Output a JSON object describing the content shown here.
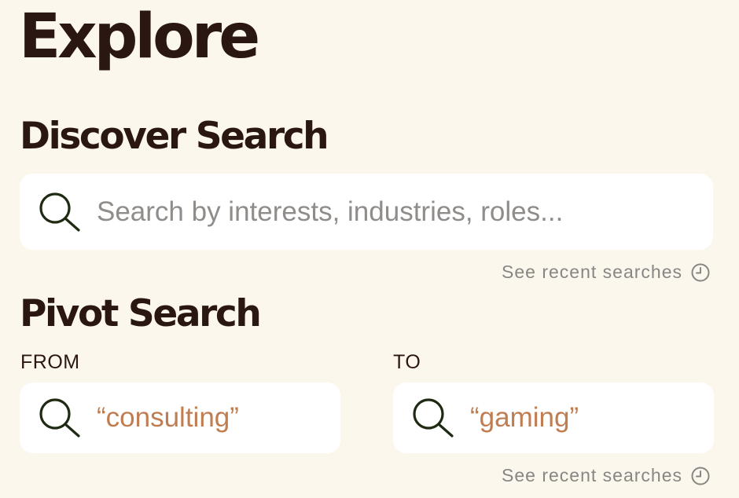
{
  "header": {
    "title": "Explore"
  },
  "discover": {
    "title": "Discover Search",
    "search": {
      "placeholder": "Search by interests, industries, roles...",
      "value": "",
      "icon": "search-icon"
    },
    "recent_link": {
      "label": "See recent searches",
      "icon": "clock-icon"
    }
  },
  "pivot": {
    "title": "Pivot Search",
    "from": {
      "label": "FROM",
      "value": "“consulting”",
      "icon": "search-icon"
    },
    "to": {
      "label": "TO",
      "value": "“gaming”",
      "icon": "search-icon"
    },
    "recent_link": {
      "label": "See recent searches",
      "icon": "clock-icon"
    }
  },
  "colors": {
    "background": "#fcf7ec",
    "text_dark": "#2b1712",
    "accent_value": "#c17d52",
    "muted": "#888684",
    "field_background": "#ffffff",
    "icon_stroke": "#1e2a12"
  }
}
